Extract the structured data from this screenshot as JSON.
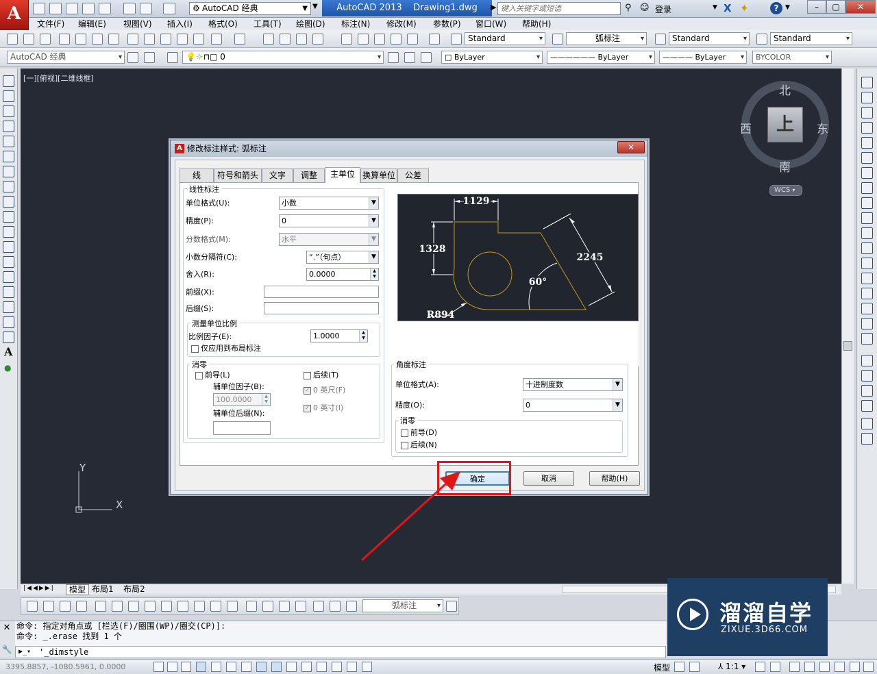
{
  "titlebar": {
    "workspace": "AutoCAD 经典",
    "app_title": "AutoCAD 2013",
    "document": "Drawing1.dwg",
    "search_placeholder": "键入关键字或短语",
    "login": "登录"
  },
  "menu": [
    "文件(F)",
    "编辑(E)",
    "视图(V)",
    "插入(I)",
    "格式(O)",
    "工具(T)",
    "绘图(D)",
    "标注(N)",
    "修改(M)",
    "参数(P)",
    "窗口(W)",
    "帮助(H)"
  ],
  "toolbar": {
    "text_style": "Standard",
    "dim_style": "弧标注",
    "table_style": "Standard",
    "multileader_style": "Standard",
    "workspace_combo": "AutoCAD 经典",
    "layer": "0",
    "color": "ByLayer",
    "linetype": "ByLayer",
    "lineweight": "ByLayer",
    "plotstyle": "BYCOLOR"
  },
  "viewport": {
    "label": "[一][俯视][二维线框]",
    "compass_n": "北",
    "compass_s": "南",
    "compass_e": "东",
    "compass_w": "西",
    "cube_face": "上",
    "wcs": "WCS",
    "ucs_x": "X",
    "ucs_y": "Y"
  },
  "dialog": {
    "title": "修改标注样式: 弧标注",
    "tabs": [
      "线",
      "符号和箭头",
      "文字",
      "调整",
      "主单位",
      "换算单位",
      "公差"
    ],
    "active_tab": "主单位",
    "linear": {
      "title": "线性标注",
      "unit_format_label": "单位格式(U):",
      "unit_format": "小数",
      "precision_label": "精度(P):",
      "precision": "0",
      "fraction_label": "分数格式(M):",
      "fraction": "水平",
      "decimal_sep_label": "小数分隔符(C):",
      "decimal_sep": "“.”（句点）",
      "roundoff_label": "舍入(R):",
      "roundoff": "0.0000",
      "prefix_label": "前缀(X):",
      "suffix_label": "后缀(S):"
    },
    "scale": {
      "title": "测量单位比例",
      "factor_label": "比例因子(E):",
      "factor": "1.0000",
      "layout_only": "仅应用到布局标注"
    },
    "zero": {
      "title": "消零",
      "leading": "前导(L)",
      "trailing": "后续(T)",
      "sub_factor_label": "辅单位因子(B):",
      "sub_factor": "100.0000",
      "sub_suffix_label": "辅单位后缀(N):",
      "feet": "0 英尺(F)",
      "inches": "0 英寸(I)"
    },
    "angular": {
      "title": "角度标注",
      "unit_format_label": "单位格式(A):",
      "unit_format": "十进制度数",
      "precision_label": "精度(O):",
      "precision": "0",
      "zero_title": "消零",
      "leading": "前导(D)",
      "trailing": "后续(N)"
    },
    "preview": {
      "dim_top": "1129",
      "dim_left": "1328",
      "dim_right": "2245",
      "angle": "60°",
      "radius": "R894"
    },
    "ok": "确定",
    "cancel": "取消",
    "help": "帮助(H)"
  },
  "layout_tabs": [
    "模型",
    "布局1",
    "布局2"
  ],
  "dim_toolbar_combo": "弧标注",
  "command": {
    "line1": "命令: 指定对角点或 [栏选(F)/圈围(WP)/圈交(CP)]:",
    "line2": "命令: _.erase 找到 1 个",
    "input": "'_dimstyle"
  },
  "status": {
    "coords": "3395.8857, -1080.5961, 0.0000",
    "model": "模型",
    "scale": "1:1"
  },
  "watermark": {
    "name": "溜溜自学",
    "url": "ZIXUE.3D66.COM"
  },
  "colors": {
    "canvas": "#252a34",
    "highlight": "#e01515",
    "preview_line": "#c8961e"
  }
}
